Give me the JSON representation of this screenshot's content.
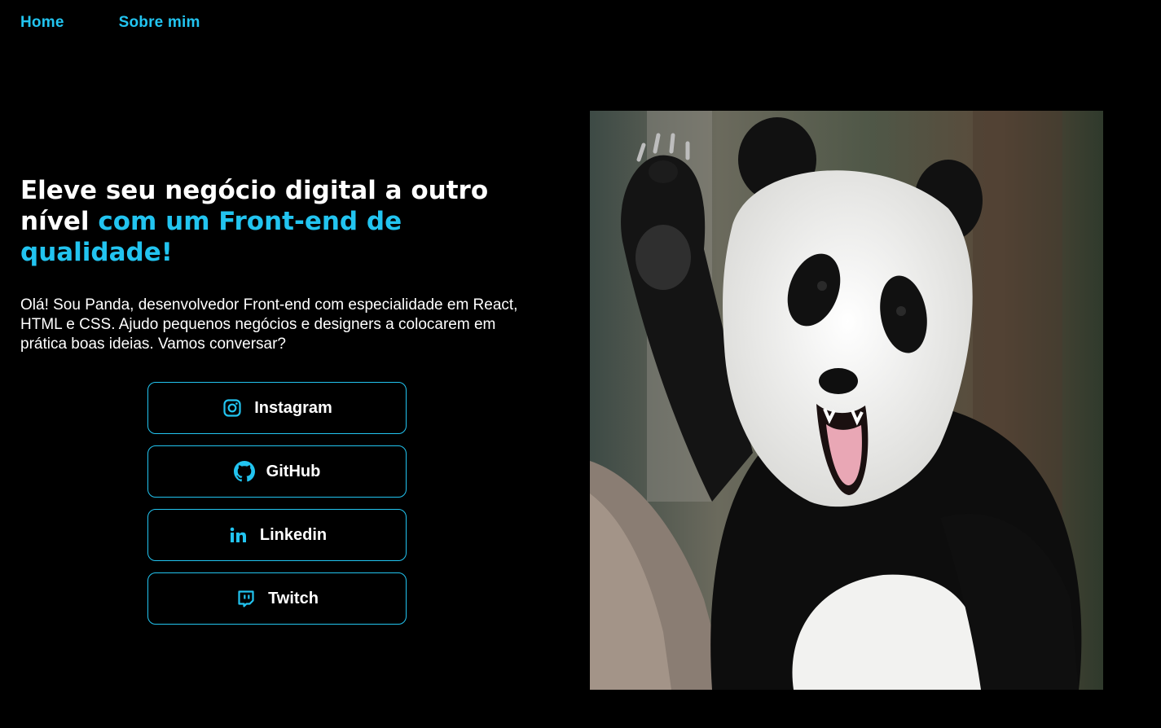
{
  "nav": {
    "items": [
      {
        "label": "Home"
      },
      {
        "label": "Sobre mim"
      }
    ]
  },
  "hero": {
    "headline_white": "Eleve seu negócio digital a outro nível ",
    "headline_accent": "com um Front-end de qualidade!",
    "intro": "Olá! Sou Panda, desenvolvedor Front-end com especialidade em React, HTML e CSS. Ajudo pequenos negócios e designers a colocarem em prática boas ideias. Vamos conversar?"
  },
  "links": [
    {
      "label": "Instagram",
      "icon": "instagram-icon"
    },
    {
      "label": "GitHub",
      "icon": "github-icon"
    },
    {
      "label": "Linkedin",
      "icon": "linkedin-icon"
    },
    {
      "label": "Twitch",
      "icon": "twitch-icon"
    }
  ],
  "colors": {
    "background": "#000000",
    "accent": "#22c4f0",
    "text": "#ffffff"
  }
}
